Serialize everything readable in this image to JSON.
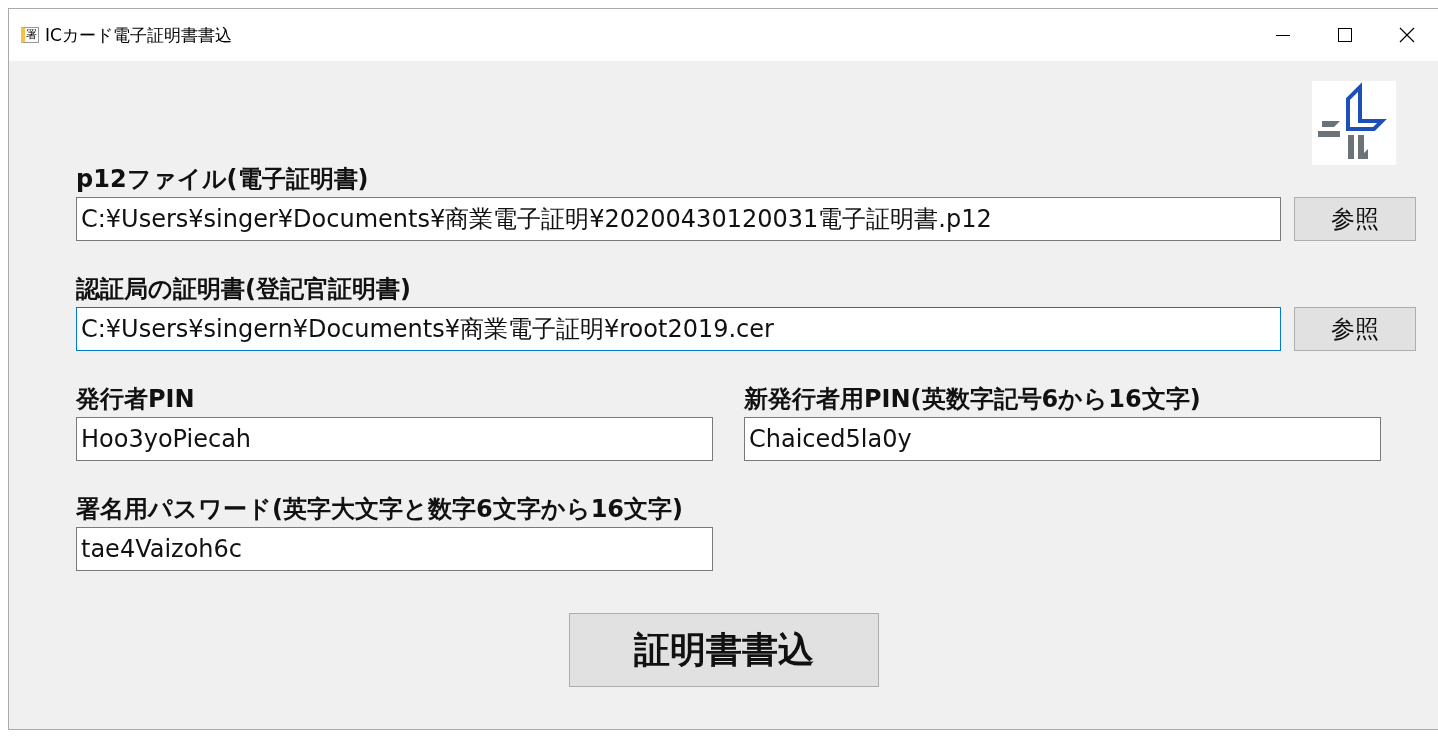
{
  "window": {
    "icon_text": "署",
    "title": "ICカード電子証明書書込"
  },
  "file_rows": [
    {
      "label": "p12ファイル(電子証明書)",
      "value": "C:¥Users¥singer¥Documents¥商業電子証明¥20200430120031電子証明書.p12",
      "focused": false,
      "button": "参照"
    },
    {
      "label": "認証局の証明書(登記官証明書)",
      "value": "C:¥Users¥singern¥Documents¥商業電子証明¥root2019.cer",
      "focused": true,
      "button": "参照"
    }
  ],
  "pin_fields": [
    {
      "label": "発行者PIN",
      "value": "Hoo3yoPiecah",
      "focused": false
    },
    {
      "label": "新発行者用PIN(英数字記号6から16文字)",
      "value": "Chaiced5la0y",
      "focused": false
    },
    {
      "label": "署名用パスワード(英字大文字と数字6文字から16文字)",
      "value": "tae4Vaizoh6c",
      "focused": false
    }
  ],
  "submit_button": "証明書書込"
}
